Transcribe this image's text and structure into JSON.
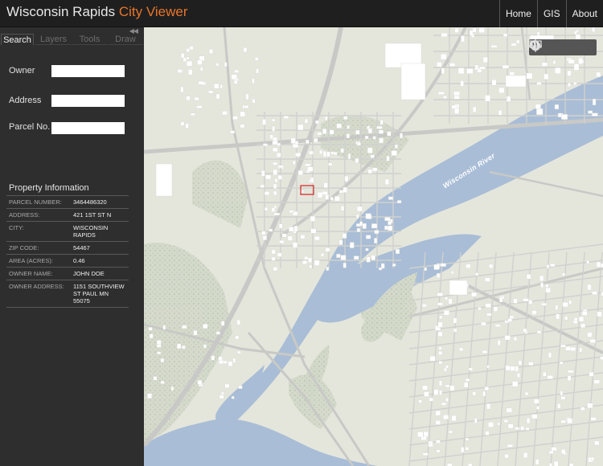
{
  "header": {
    "title_main": "Wisconsin Rapids",
    "title_accent": "City Viewer",
    "accent_color": "#e8752a",
    "nav": [
      "Home",
      "GIS",
      "About"
    ]
  },
  "sidebar": {
    "tabs": [
      "Search",
      "Layers",
      "Tools",
      "Draw"
    ],
    "active_tab": "Search",
    "collapse_icon": "double-chevron-left-icon",
    "search": {
      "owner_label": "Owner",
      "owner_value": "",
      "address_label": "Address",
      "address_value": "",
      "parcel_label": "Parcel No.",
      "parcel_value": ""
    },
    "property": {
      "title": "Property Information",
      "rows": [
        {
          "key": "PARCEL NUMBER:",
          "value": "3464486320"
        },
        {
          "key": "ADDRESS:",
          "value": "421 1ST ST N"
        },
        {
          "key": "CITY:",
          "value": "WISCONSIN RAPIDS"
        },
        {
          "key": "ZIP CODE:",
          "value": "54467"
        },
        {
          "key": "AREA (ACRES):",
          "value": "0.46"
        },
        {
          "key": "OWNER NAME:",
          "value": "JOHN DOE"
        },
        {
          "key": "OWNER ADDRESS:",
          "value": "1151 SOUTHVIEW\nST PAUL MN\n55075"
        }
      ]
    }
  },
  "map": {
    "river_label": "Wisconsin River",
    "tools": [
      "globe-icon",
      "crosshair-icon",
      "screen-icon"
    ],
    "colors": {
      "land": "#e4e6dc",
      "water": "#a9bdd6",
      "roads": "#c8c9c6",
      "buildings": "#ffffff",
      "forest": "#cdd5c3",
      "selection": "#d62020"
    }
  }
}
